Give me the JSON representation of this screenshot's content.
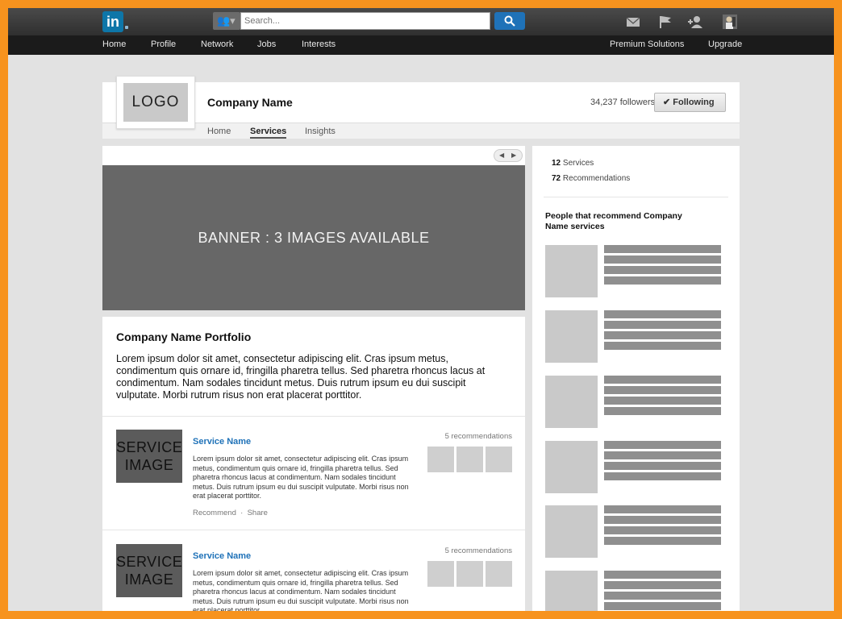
{
  "topbar": {
    "brand": "in",
    "search_placeholder": "Search...",
    "icons": [
      "people-icon",
      "search-icon",
      "mail-icon",
      "flag-icon",
      "add-connection-icon",
      "profile-avatar-icon"
    ]
  },
  "nav": {
    "left": [
      "Home",
      "Profile",
      "Network",
      "Jobs",
      "Interests"
    ],
    "right": [
      "Premium Solutions",
      "Upgrade"
    ]
  },
  "company": {
    "logo": "LOGO",
    "name": "Company Name",
    "followers": "34,237 followers",
    "follow_label": "Following",
    "tabs": [
      "Home",
      "Services",
      "Insights"
    ],
    "active_tab": "Services"
  },
  "banner": {
    "label": "BANNER : 3 IMAGES AVAILABLE"
  },
  "portfolio": {
    "title": "Company Name Portfolio",
    "description": "Lorem ipsum dolor sit amet, consectetur adipiscing elit. Cras ipsum metus, condimentum quis ornare id, fringilla pharetra tellus. Sed pharetra rhoncus lacus at condimentum. Nam sodales tincidunt metus. Duis rutrum ipsum eu dui suscipit vulputate. Morbi rutrum risus non erat placerat porttitor."
  },
  "services": [
    {
      "image_label": "SERVICE IMAGE",
      "name": "Service Name",
      "description": "Lorem ipsum dolor sit amet, consectetur adipiscing elit. Cras ipsum metus, condimentum quis ornare id, fringilla pharetra tellus. Sed pharetra rhoncus lacus at condimentum. Nam sodales tincidunt metus. Duis rutrum ipsum eu dui suscipit vulputate. Morbi risus non erat placerat porttitor.",
      "recommendations": "5 recommendations",
      "recommend_label": "Recommend",
      "share_label": "Share"
    },
    {
      "image_label": "SERVICE IMAGE",
      "name": "Service Name",
      "description": "Lorem ipsum dolor sit amet, consectetur adipiscing elit. Cras ipsum metus, condimentum quis ornare id, fringilla pharetra tellus. Sed pharetra rhoncus lacus at condimentum. Nam sodales tincidunt metus. Duis rutrum ipsum eu dui suscipit vulputate. Morbi risus non erat placerat porttitor.",
      "recommendations": "5 recommendations"
    }
  ],
  "sidebar": {
    "services_count": "12",
    "services_label": "Services",
    "recommendations_count": "72",
    "recommendations_label": "Recommendations",
    "recommenders_title": "People that recommend Company Name services"
  },
  "colors": {
    "frame": "#f7931e",
    "brand_blue": "#0e76a8",
    "link_blue": "#1f72b8",
    "banner": "#676767"
  }
}
